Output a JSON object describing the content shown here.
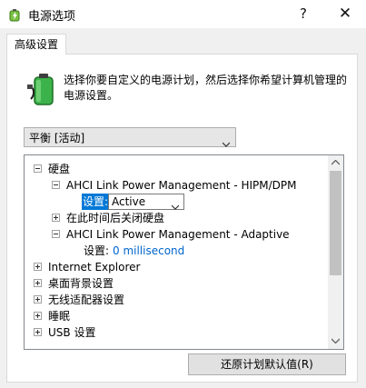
{
  "window": {
    "title": "电源选项",
    "help_glyph": "?",
    "close_glyph": "✕"
  },
  "tab": {
    "label": "高级设置"
  },
  "description": "选择你要自定义的电源计划，然后选择你希望计算机管理的电源设置。",
  "plan_select": {
    "value": "平衡 [活动]"
  },
  "tree": {
    "items": [
      {
        "label": "硬盘"
      },
      {
        "label": "AHCI Link Power Management - HIPM/DPM"
      },
      {
        "label": "设置:",
        "value": "Active"
      },
      {
        "label": "在此时间后关闭硬盘"
      },
      {
        "label": "AHCI Link Power Management - Adaptive"
      },
      {
        "label": "设置:",
        "value": "0 millisecond"
      },
      {
        "label": "Internet Explorer"
      },
      {
        "label": "桌面背景设置"
      },
      {
        "label": "无线适配器设置"
      },
      {
        "label": "睡眠"
      },
      {
        "label": "USB 设置"
      }
    ]
  },
  "buttons": {
    "restore_defaults": "还原计划默认值(R)"
  },
  "colors": {
    "accent": "#0078d7",
    "link": "#0066cc",
    "battery_green": "#2ea043"
  }
}
